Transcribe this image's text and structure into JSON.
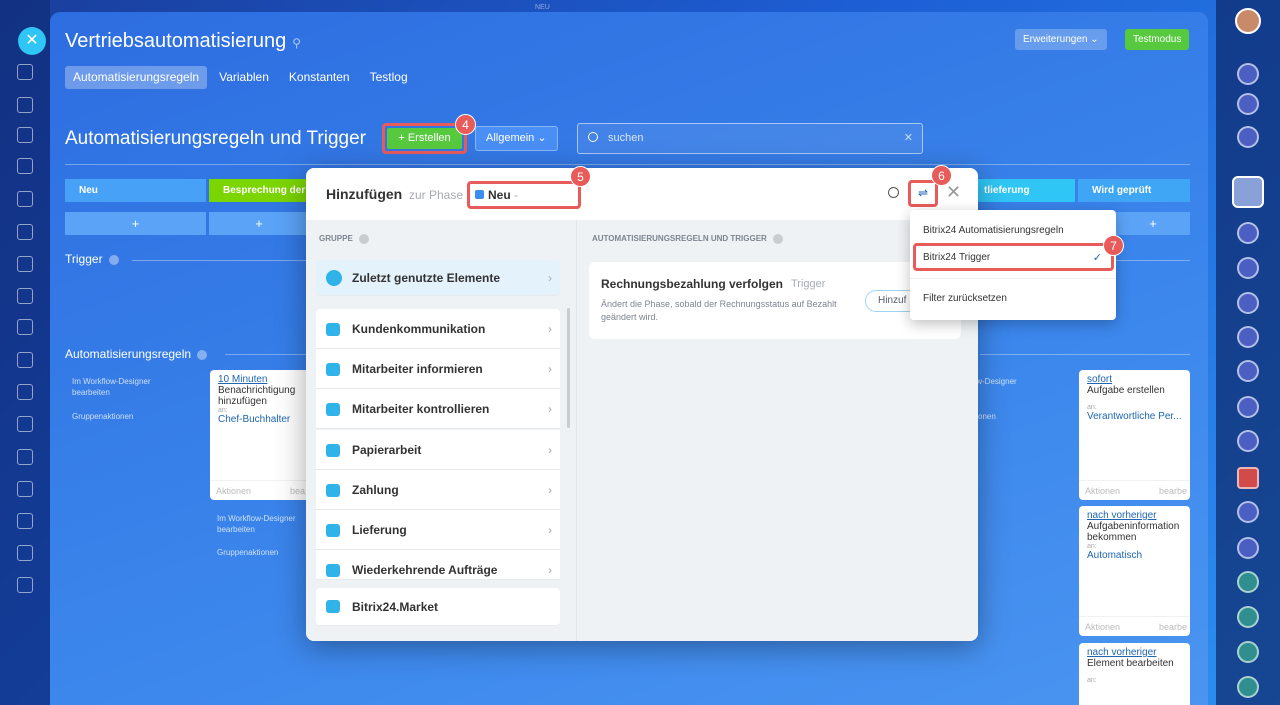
{
  "top_label": "NEU",
  "header": {
    "title": "Vertriebsautomatisierung",
    "extensions_label": "Erweiterungen",
    "test_mode_label": "Testmodus"
  },
  "tabs": [
    {
      "label": "Automatisierungsregeln"
    },
    {
      "label": "Variablen"
    },
    {
      "label": "Konstanten"
    },
    {
      "label": "Testlog"
    }
  ],
  "section": {
    "title": "Automatisierungsregeln und Trigger",
    "create_label": "+ Erstellen",
    "general_label": "Allgemein",
    "search_placeholder": "suchen"
  },
  "badges": [
    "4",
    "5",
    "6",
    "7"
  ],
  "stages": [
    {
      "label": "Neu",
      "color": "#47a2f7"
    },
    {
      "label": "Besprechung der",
      "color": "#7bd500"
    },
    {
      "label": "tlieferung",
      "color": "#2fc6f6"
    },
    {
      "label": "Wird geprüft",
      "color": "#3fa6f5"
    }
  ],
  "plus": "+",
  "trigger_label": "Trigger",
  "rules_label": "Automatisierungsregeln",
  "side_text": {
    "designer": "Im Workflow-Designer bearbeiten",
    "group_actions": "Gruppenaktionen",
    "designer_right": "low-Designer",
    "designer_right2": "n",
    "group_actions_right": "ktionen"
  },
  "cards": {
    "left": {
      "time": "10 Minuten",
      "text": "Benachrichtigung hinzufügen",
      "an": "an:",
      "who": "Chef-Buchhalter",
      "foot_a": "Aktionen",
      "foot_b": "bea"
    },
    "right1": {
      "time": "sofort",
      "text": "Aufgabe erstellen",
      "an": "an:",
      "who": "Verantwortliche Per...",
      "foot_a": "Aktionen",
      "foot_b": "bearbe"
    },
    "right2": {
      "time": "nach vorheriger",
      "text": "Aufgabeninformation bekommen",
      "an": "an:",
      "who": "Automatisch",
      "foot_a": "Aktionen",
      "foot_b": "bearbe"
    },
    "right3": {
      "time": "nach vorheriger",
      "text": "Element bearbeiten",
      "an": "an:"
    }
  },
  "popup": {
    "title": "Hinzufügen",
    "subtitle": "zur Phase",
    "phase": "Neu",
    "groups_header": "GRUPPE",
    "groups": [
      {
        "label": "Zuletzt genutzte Elemente"
      },
      {
        "label": "Kundenkommunikation"
      },
      {
        "label": "Mitarbeiter informieren"
      },
      {
        "label": "Mitarbeiter kontrollieren"
      },
      {
        "label": "Papierarbeit"
      },
      {
        "label": "Zahlung"
      },
      {
        "label": "Lieferung"
      },
      {
        "label": "Wiederkehrende Aufträge"
      },
      {
        "label": "Bitrix24.Market"
      }
    ],
    "rules_header": "AUTOMATISIERUNGSREGELN UND TRIGGER",
    "item": {
      "title": "Rechnungsbezahlung verfolgen",
      "tag": "Trigger",
      "desc": "Ändert die Phase, sobald der Rechnungsstatus auf Bezahlt geändert wird.",
      "button": "Hinzuf"
    }
  },
  "dropdown": {
    "items": [
      "Bitrix24 Automatisierungsregeln",
      "Bitrix24 Trigger",
      "Filter zurücksetzen"
    ],
    "check": "✓"
  }
}
